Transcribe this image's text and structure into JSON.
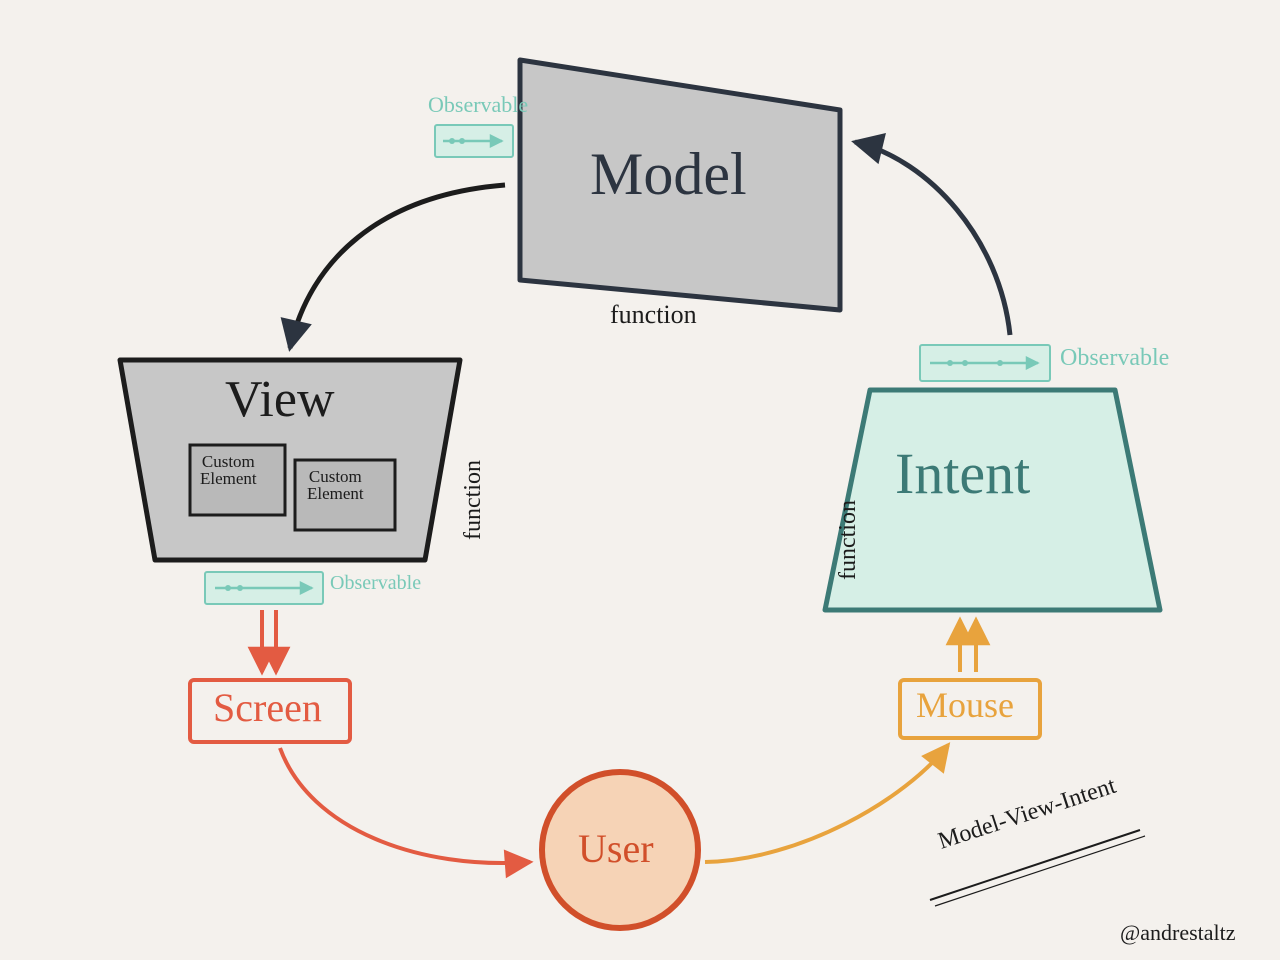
{
  "nodes": {
    "model": {
      "title": "Model",
      "sub": "function"
    },
    "view": {
      "title": "View",
      "sub": "function",
      "children": [
        "Custom\nElement",
        "Custom\nElement"
      ]
    },
    "intent": {
      "title": "Intent",
      "sub": "function"
    },
    "user": {
      "title": "User"
    },
    "screen": {
      "title": "Screen"
    },
    "mouse": {
      "title": "Mouse"
    }
  },
  "observable_label": "Observable",
  "footer": {
    "title": "Model-View-Intent",
    "credit": "@andrestaltz"
  },
  "colors": {
    "dark": "#2c3440",
    "teal": "#3c7a76",
    "mint": "#79c9b8",
    "grayFill": "#c7c7c7",
    "red": "#e35b42",
    "orange": "#e8a33d",
    "userFill": "#f6d3b6",
    "mintBox": "#d6efe6"
  }
}
